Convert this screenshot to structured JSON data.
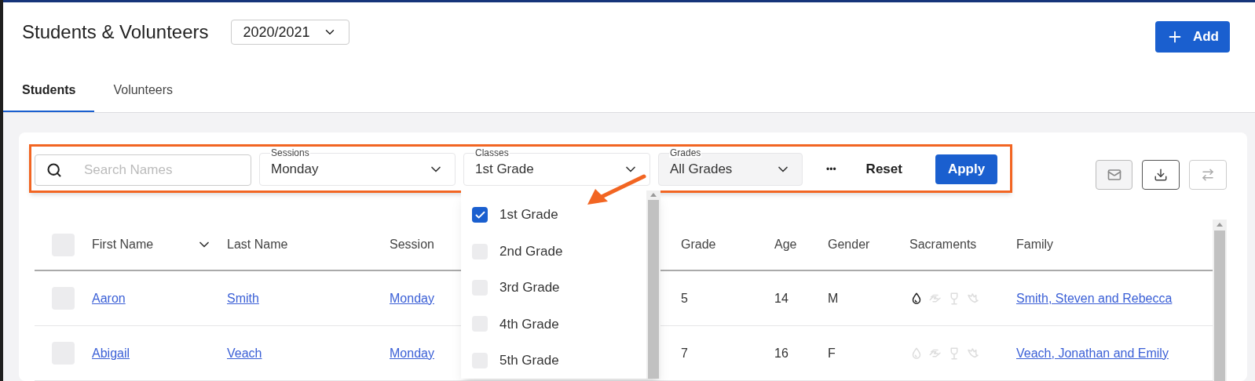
{
  "header": {
    "title": "Students & Volunteers",
    "year": "2020/2021",
    "add_button": "Add"
  },
  "tabs": [
    {
      "label": "Students",
      "selected": true
    },
    {
      "label": "Volunteers",
      "selected": false
    }
  ],
  "filters": {
    "search": {
      "placeholder": "Search Names"
    },
    "sessions": {
      "label": "Sessions",
      "value": "Monday"
    },
    "classes": {
      "label": "Classes",
      "value": "1st Grade",
      "expanded": true,
      "options": [
        {
          "label": "1st Grade",
          "checked": true
        },
        {
          "label": "2nd Grade",
          "checked": false
        },
        {
          "label": "3rd Grade",
          "checked": false
        },
        {
          "label": "4th Grade",
          "checked": false
        },
        {
          "label": "5th Grade",
          "checked": false
        }
      ]
    },
    "grades": {
      "label": "Grades",
      "value": "All Grades"
    },
    "more": "•••",
    "reset": "Reset",
    "apply": "Apply"
  },
  "table": {
    "select_all_checked": false,
    "columns": [
      "First Name",
      "Last Name",
      "Session",
      "Grade",
      "Age",
      "Gender",
      "Sacraments",
      "Family"
    ],
    "rows": [
      {
        "checked": false,
        "first_name": "Aaron",
        "last_name": "Smith",
        "session": "Monday",
        "grade": "5",
        "age": "14",
        "gender": "M",
        "sacraments": [
          {
            "kind": "drop",
            "received": true
          },
          {
            "kind": "hands",
            "received": false
          },
          {
            "kind": "cup",
            "received": false
          },
          {
            "kind": "dove",
            "received": false
          }
        ],
        "family": "Smith, Steven and Rebecca"
      },
      {
        "checked": false,
        "first_name": "Abigail",
        "last_name": "Veach",
        "session": "Monday",
        "grade": "7",
        "age": "16",
        "gender": "F",
        "sacraments": [
          {
            "kind": "drop",
            "received": false
          },
          {
            "kind": "hands",
            "received": false
          },
          {
            "kind": "cup",
            "received": false
          },
          {
            "kind": "dove",
            "received": false
          }
        ],
        "family": "Veach, Jonathan and Emily"
      }
    ]
  }
}
